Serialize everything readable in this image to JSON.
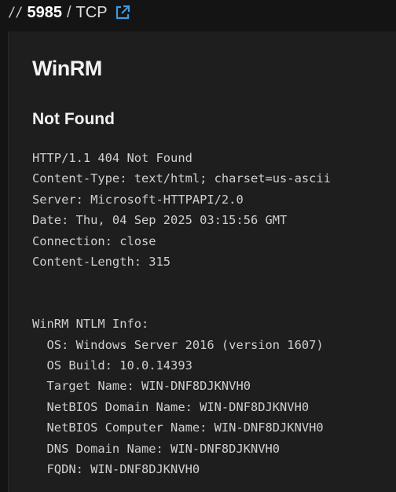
{
  "header": {
    "prefix": "//",
    "port": "5985",
    "separator": "/",
    "protocol": "TCP",
    "link_icon": "external-link-icon",
    "link_color": "#3b9ae1"
  },
  "service": {
    "name": "WinRM",
    "status_title": "Not Found",
    "banner_lines": [
      "HTTP/1.1 404 Not Found",
      "Content-Type: text/html; charset=us-ascii",
      "Server: Microsoft-HTTPAPI/2.0",
      "Date: Thu, 04 Sep 2025 03:15:56 GMT",
      "Connection: close",
      "Content-Length: 315",
      "",
      "",
      "WinRM NTLM Info:",
      "  OS: Windows Server 2016 (version 1607)",
      "  OS Build: 10.0.14393",
      "  Target Name: WIN-DNF8DJKNVH0",
      "  NetBIOS Domain Name: WIN-DNF8DJKNVH0",
      "  NetBIOS Computer Name: WIN-DNF8DJKNVH0",
      "  DNS Domain Name: WIN-DNF8DJKNVH0",
      "  FQDN: WIN-DNF8DJKNVH0"
    ]
  }
}
